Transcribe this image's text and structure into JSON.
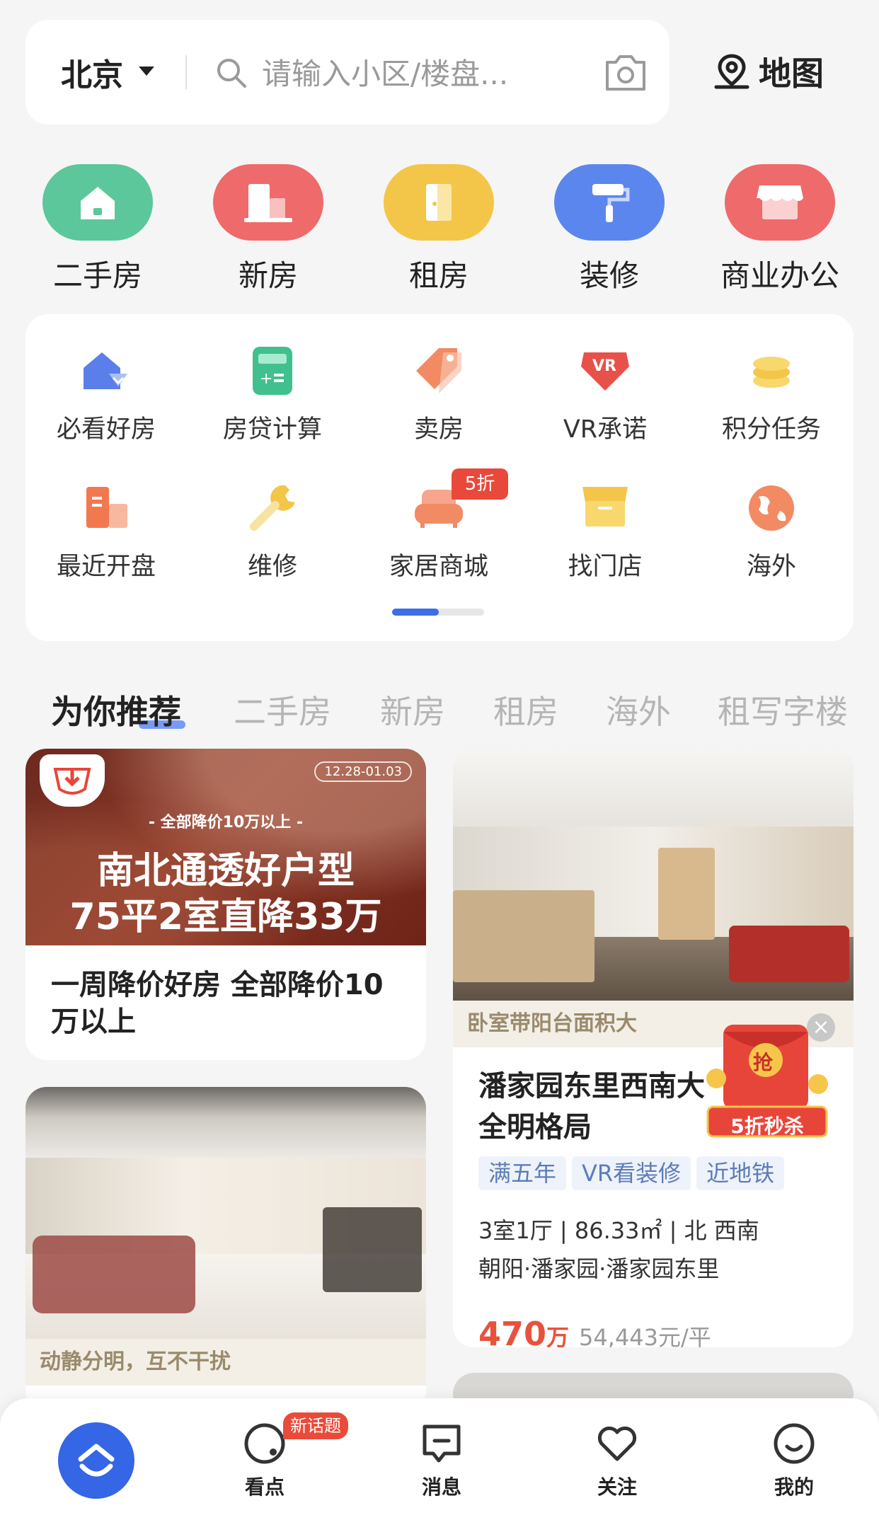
{
  "header": {
    "city": "北京",
    "search_placeholder": "请输入小区/楼盘...",
    "map_label": "地图"
  },
  "categories": [
    {
      "label": "二手房",
      "color": "#5cc79a"
    },
    {
      "label": "新房",
      "color": "#ef6a6a"
    },
    {
      "label": "租房",
      "color": "#f3c64a"
    },
    {
      "label": "装修",
      "color": "#5b86ee"
    },
    {
      "label": "商业办公",
      "color": "#ef6a6a"
    }
  ],
  "tools": [
    {
      "label": "必看好房"
    },
    {
      "label": "房贷计算"
    },
    {
      "label": "卖房"
    },
    {
      "label": "VR承诺"
    },
    {
      "label": "积分任务"
    },
    {
      "label": "最近开盘"
    },
    {
      "label": "维修"
    },
    {
      "label": "家居商城",
      "badge": "5折"
    },
    {
      "label": "找门店"
    },
    {
      "label": "海外"
    }
  ],
  "tabs": [
    "为你推荐",
    "二手房",
    "新房",
    "租房",
    "海外",
    "租写字楼"
  ],
  "promo_card": {
    "date": "12.28-01.03",
    "subtitle": "- 全部降价10万以上 -",
    "headline1": "南北通透好户型",
    "headline2": "75平2室直降33万",
    "title": "一周降价好房 全部降价10万以上"
  },
  "listing_card": {
    "caption": "卧室带阳台面积大",
    "title": "潘家园东里西南大全明格局",
    "tags": [
      "满五年",
      "VR看装修",
      "近地铁"
    ],
    "specs": "3室1厅 | 86.33㎡ | 北 西南",
    "location": "朝阳·潘家园·潘家园东里",
    "price": "470",
    "price_unit": "万",
    "unit_price": "54,443元/平",
    "flash_badge": "5折秒杀",
    "flash_grab": "抢"
  },
  "second_card": {
    "caption": "动静分明，互不干扰"
  },
  "bottom_nav": {
    "items": [
      "看点",
      "消息",
      "关注",
      "我的"
    ],
    "badge": "新话题"
  }
}
